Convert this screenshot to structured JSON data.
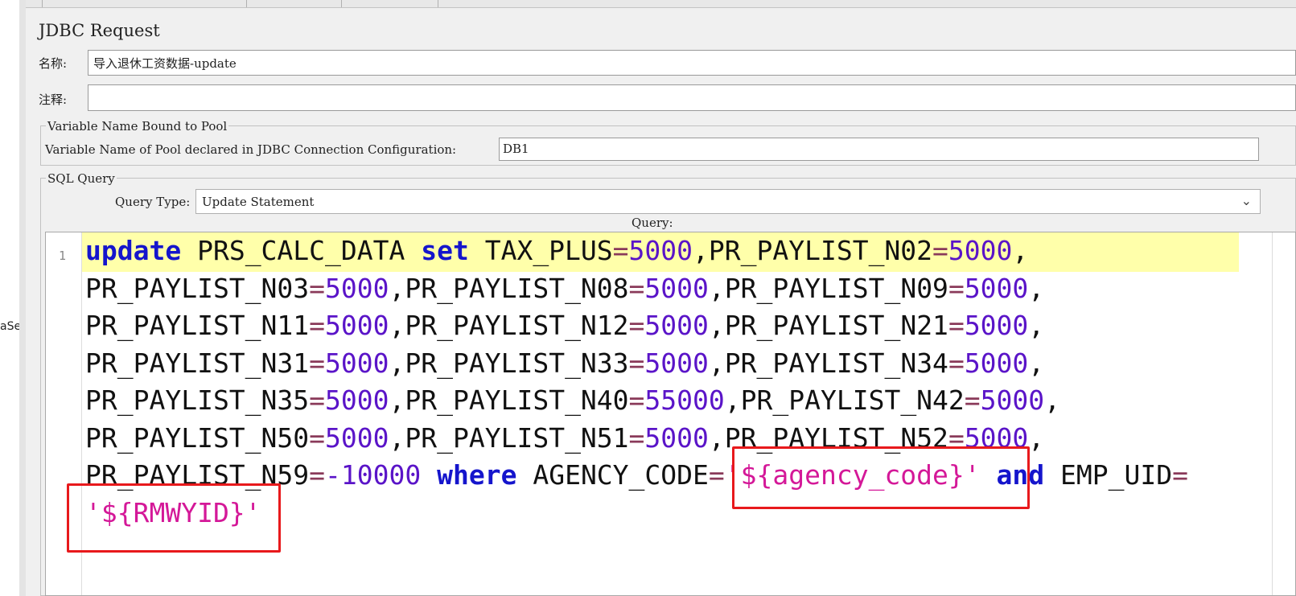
{
  "sidebar": {
    "clipped_item_text": "aSe"
  },
  "panel": {
    "title": "JDBC Request",
    "name_label": "名称:",
    "name_value": "导入退休工资数据-update",
    "comment_label": "注释:",
    "comment_value": ""
  },
  "pool_group": {
    "legend": "Variable Name Bound to Pool",
    "label": "Variable Name of Pool declared in JDBC Connection Configuration:",
    "value": "DB1"
  },
  "sql_group": {
    "legend": "SQL Query",
    "query_type_label": "Query Type:",
    "query_type_value": "Update Statement",
    "query_label": "Query:"
  },
  "editor": {
    "line_number": "1",
    "current_line_highlight": "#ffffaa",
    "lines": [
      [
        [
          "kw",
          "update"
        ],
        [
          "id",
          " PRS_CALC_DATA "
        ],
        [
          "kw",
          "set"
        ],
        [
          "id",
          " TAX_PLUS"
        ],
        [
          "op",
          "="
        ],
        [
          "num",
          "5000"
        ],
        [
          "punct",
          ","
        ],
        [
          "id",
          "PR_PAYLIST_N02"
        ],
        [
          "op",
          "="
        ],
        [
          "num",
          "5000"
        ],
        [
          "punct",
          ","
        ]
      ],
      [
        [
          "id",
          "PR_PAYLIST_N03"
        ],
        [
          "op",
          "="
        ],
        [
          "num",
          "5000"
        ],
        [
          "punct",
          ","
        ],
        [
          "id",
          "PR_PAYLIST_N08"
        ],
        [
          "op",
          "="
        ],
        [
          "num",
          "5000"
        ],
        [
          "punct",
          ","
        ],
        [
          "id",
          "PR_PAYLIST_N09"
        ],
        [
          "op",
          "="
        ],
        [
          "num",
          "5000"
        ],
        [
          "punct",
          ","
        ]
      ],
      [
        [
          "id",
          "PR_PAYLIST_N11"
        ],
        [
          "op",
          "="
        ],
        [
          "num",
          "5000"
        ],
        [
          "punct",
          ","
        ],
        [
          "id",
          "PR_PAYLIST_N12"
        ],
        [
          "op",
          "="
        ],
        [
          "num",
          "5000"
        ],
        [
          "punct",
          ","
        ],
        [
          "id",
          "PR_PAYLIST_N21"
        ],
        [
          "op",
          "="
        ],
        [
          "num",
          "5000"
        ],
        [
          "punct",
          ","
        ]
      ],
      [
        [
          "id",
          "PR_PAYLIST_N31"
        ],
        [
          "op",
          "="
        ],
        [
          "num",
          "5000"
        ],
        [
          "punct",
          ","
        ],
        [
          "id",
          "PR_PAYLIST_N33"
        ],
        [
          "op",
          "="
        ],
        [
          "num",
          "5000"
        ],
        [
          "punct",
          ","
        ],
        [
          "id",
          "PR_PAYLIST_N34"
        ],
        [
          "op",
          "="
        ],
        [
          "num",
          "5000"
        ],
        [
          "punct",
          ","
        ]
      ],
      [
        [
          "id",
          "PR_PAYLIST_N35"
        ],
        [
          "op",
          "="
        ],
        [
          "num",
          "5000"
        ],
        [
          "punct",
          ","
        ],
        [
          "id",
          "PR_PAYLIST_N40"
        ],
        [
          "op",
          "="
        ],
        [
          "num",
          "55000"
        ],
        [
          "punct",
          ","
        ],
        [
          "id",
          "PR_PAYLIST_N42"
        ],
        [
          "op",
          "="
        ],
        [
          "num",
          "5000"
        ],
        [
          "punct",
          ","
        ]
      ],
      [
        [
          "id",
          "PR_PAYLIST_N50"
        ],
        [
          "op",
          "="
        ],
        [
          "num",
          "5000"
        ],
        [
          "punct",
          ","
        ],
        [
          "id",
          "PR_PAYLIST_N51"
        ],
        [
          "op",
          "="
        ],
        [
          "num",
          "5000"
        ],
        [
          "punct",
          ","
        ],
        [
          "id",
          "PR_PAYLIST_N52"
        ],
        [
          "op",
          "="
        ],
        [
          "num",
          "5000"
        ],
        [
          "punct",
          ","
        ]
      ],
      [
        [
          "id",
          "PR_PAYLIST_N59"
        ],
        [
          "op",
          "="
        ],
        [
          "num",
          "-10000"
        ],
        [
          "id",
          " "
        ],
        [
          "kw",
          "where"
        ],
        [
          "id",
          " AGENCY_CODE"
        ],
        [
          "op",
          "="
        ],
        [
          "str",
          "'${agency_code}'"
        ],
        [
          "id",
          " "
        ],
        [
          "kw",
          "and"
        ],
        [
          "id",
          " EMP_UID"
        ],
        [
          "op",
          "="
        ]
      ],
      [
        [
          "str",
          "'${RMWYID}'"
        ]
      ]
    ]
  },
  "highlight_color": "#e8191c"
}
